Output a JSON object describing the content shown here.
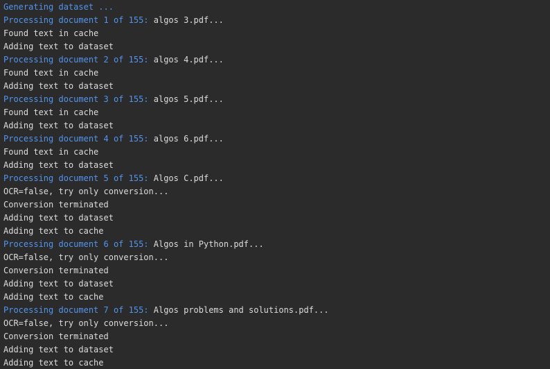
{
  "console": {
    "colors": {
      "background": "#2b2b2b",
      "text": "#dcdcdc",
      "info": "#5394ec"
    },
    "lines": [
      {
        "type": "info",
        "prefix": "Generating dataset ...",
        "suffix": ""
      },
      {
        "type": "info",
        "prefix": "Processing document 1 of 155:",
        "suffix": " algos 3.pdf..."
      },
      {
        "type": "plain",
        "prefix": "",
        "suffix": "Found text in cache"
      },
      {
        "type": "plain",
        "prefix": "",
        "suffix": "Adding text to dataset"
      },
      {
        "type": "info",
        "prefix": "Processing document 2 of 155:",
        "suffix": " algos 4.pdf..."
      },
      {
        "type": "plain",
        "prefix": "",
        "suffix": "Found text in cache"
      },
      {
        "type": "plain",
        "prefix": "",
        "suffix": "Adding text to dataset"
      },
      {
        "type": "info",
        "prefix": "Processing document 3 of 155:",
        "suffix": " algos 5.pdf..."
      },
      {
        "type": "plain",
        "prefix": "",
        "suffix": "Found text in cache"
      },
      {
        "type": "plain",
        "prefix": "",
        "suffix": "Adding text to dataset"
      },
      {
        "type": "info",
        "prefix": "Processing document 4 of 155:",
        "suffix": " algos 6.pdf..."
      },
      {
        "type": "plain",
        "prefix": "",
        "suffix": "Found text in cache"
      },
      {
        "type": "plain",
        "prefix": "",
        "suffix": "Adding text to dataset"
      },
      {
        "type": "info",
        "prefix": "Processing document 5 of 155:",
        "suffix": " Algos C.pdf..."
      },
      {
        "type": "plain",
        "prefix": "",
        "suffix": "OCR=false, try only conversion..."
      },
      {
        "type": "plain",
        "prefix": "",
        "suffix": "Conversion terminated"
      },
      {
        "type": "plain",
        "prefix": "",
        "suffix": "Adding text to dataset"
      },
      {
        "type": "plain",
        "prefix": "",
        "suffix": "Adding text to cache"
      },
      {
        "type": "info",
        "prefix": "Processing document 6 of 155:",
        "suffix": " Algos in Python.pdf..."
      },
      {
        "type": "plain",
        "prefix": "",
        "suffix": "OCR=false, try only conversion..."
      },
      {
        "type": "plain",
        "prefix": "",
        "suffix": "Conversion terminated"
      },
      {
        "type": "plain",
        "prefix": "",
        "suffix": "Adding text to dataset"
      },
      {
        "type": "plain",
        "prefix": "",
        "suffix": "Adding text to cache"
      },
      {
        "type": "info",
        "prefix": "Processing document 7 of 155:",
        "suffix": " Algos problems and solutions.pdf..."
      },
      {
        "type": "plain",
        "prefix": "",
        "suffix": "OCR=false, try only conversion..."
      },
      {
        "type": "plain",
        "prefix": "",
        "suffix": "Conversion terminated"
      },
      {
        "type": "plain",
        "prefix": "",
        "suffix": "Adding text to dataset"
      },
      {
        "type": "plain",
        "prefix": "",
        "suffix": "Adding text to cache"
      }
    ]
  }
}
